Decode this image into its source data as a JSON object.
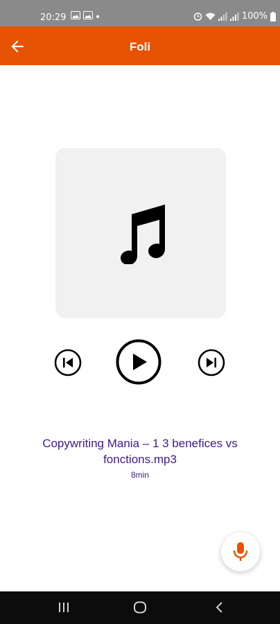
{
  "status_bar": {
    "time": "20:29",
    "battery": "100%"
  },
  "app_bar": {
    "title": "Foli",
    "color": "#e65305"
  },
  "player": {
    "track_title": "Copywriting Mania – 1 3 benefices vs fonctions.mp3",
    "duration": "8min",
    "title_color": "#3d1a8c",
    "album_icon": "music-note-icon",
    "controls": [
      "skip-previous-icon",
      "play-icon",
      "skip-next-icon"
    ]
  },
  "fab": {
    "icon": "microphone-icon",
    "accent": "#e65305"
  },
  "nav_bar": {
    "buttons": [
      "recents-icon",
      "home-icon",
      "back-icon"
    ]
  }
}
